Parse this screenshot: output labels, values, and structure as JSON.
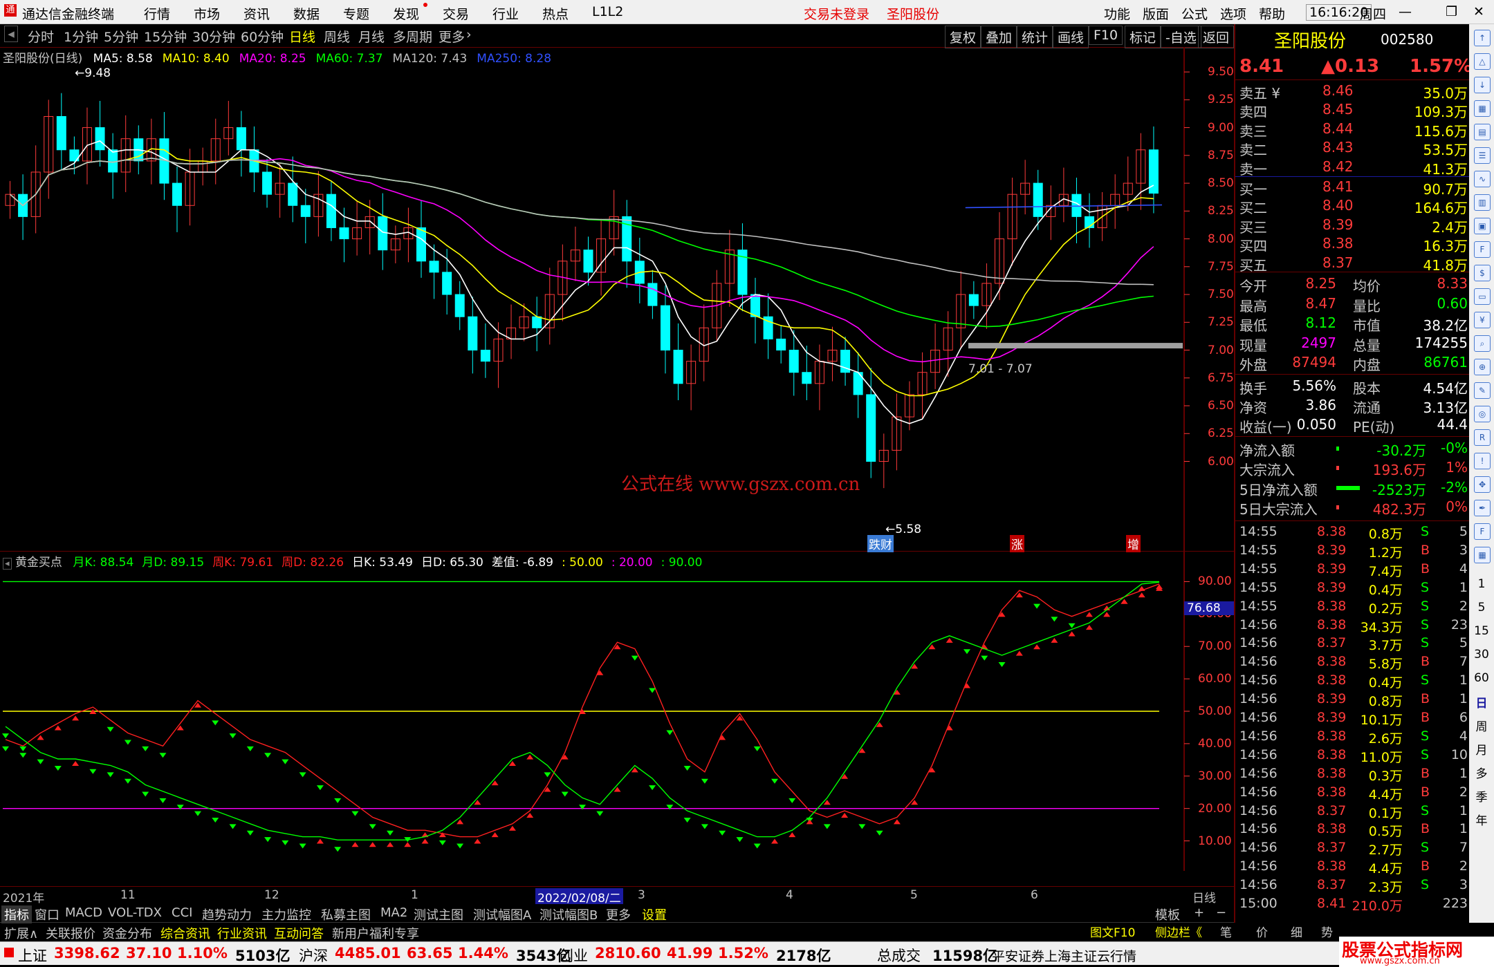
{
  "titlebar": {
    "app": "通达信金融终端",
    "menu": [
      "行情",
      "市场",
      "资讯",
      "数据",
      "专题",
      "发现",
      "交易",
      "行业",
      "热点",
      "L1L2"
    ],
    "login": "交易未登录",
    "stock": "圣阳股份",
    "right_menu": [
      "功能",
      "版面",
      "公式",
      "选项",
      "帮助"
    ],
    "time": "16:16:20",
    "weekday": "周四"
  },
  "toolbar": {
    "periods": [
      "分时",
      "1分钟",
      "5分钟",
      "15分钟",
      "30分钟",
      "60分钟",
      "日线",
      "周线",
      "月线",
      "多周期",
      "更多"
    ],
    "selected": "日线",
    "right": [
      "复权",
      "叠加",
      "统计",
      "画线",
      "F10",
      "标记",
      "-自选",
      "返回"
    ]
  },
  "ma_line": {
    "name": "圣阳股份(日线)",
    "items": [
      {
        "label": "MA5: 8.58",
        "color": "#ffffff"
      },
      {
        "label": "MA10: 8.40",
        "color": "#ffff00"
      },
      {
        "label": "MA20: 8.25",
        "color": "#ff00ff"
      },
      {
        "label": "MA60: 7.37",
        "color": "#00ff00"
      },
      {
        "label": "MA120: 7.43",
        "color": "#c0c0c0"
      },
      {
        "label": "MA250: 8.28",
        "color": "#3050ff"
      }
    ]
  },
  "price_axis": [
    "9.50",
    "9.25",
    "9.00",
    "8.75",
    "8.50",
    "8.25",
    "8.00",
    "7.75",
    "7.50",
    "7.25",
    "7.00",
    "6.75",
    "6.50",
    "6.25",
    "6.00"
  ],
  "annotations": {
    "high": "9.48",
    "low": "5.58",
    "range": "7.01 - 7.07",
    "watermark": "公式在线  www.gszx.com.cn",
    "tags": [
      "跌财",
      "涨",
      "增"
    ]
  },
  "indicator_line": {
    "name": "黄金买点",
    "items": [
      {
        "label": "月K: 88.54",
        "color": "#00ff00"
      },
      {
        "label": "月D: 89.15",
        "color": "#00ff00"
      },
      {
        "label": "周K: 79.61",
        "color": "#ff2020"
      },
      {
        "label": "周D: 82.26",
        "color": "#ff2020"
      },
      {
        "label": "日K: 53.49",
        "color": "#ffffff"
      },
      {
        "label": "日D: 65.30",
        "color": "#ffffff"
      },
      {
        "label": "差值: -6.89",
        "color": "#ffffff"
      }
    ],
    "levels": [
      {
        "label": ": 50.00",
        "color": "#ffff00"
      },
      {
        "label": ": 20.00",
        "color": "#ff00ff"
      },
      {
        "label": ": 90.00",
        "color": "#00ff00"
      }
    ]
  },
  "indicator_axis": [
    "90.00",
    "80.00",
    "70.00",
    "60.00",
    "50.00",
    "40.00",
    "30.00",
    "20.00",
    "10.00"
  ],
  "indicator_current": "76.68",
  "date_axis": {
    "labels": [
      "2021年",
      "11",
      "12",
      "1",
      "2022/02/08/二",
      "3",
      "4",
      "5",
      "6"
    ],
    "period": "日线"
  },
  "bottom_tabs": [
    "指标",
    "窗口",
    "MACD",
    "VOL-TDX",
    "CCI",
    "趋势动力",
    "主力监控",
    "私募主图",
    "MA2",
    "测试主图",
    "测试幅图A",
    "测试幅图B",
    "更多",
    "设置"
  ],
  "bottom_tabs2": [
    "扩展∧",
    "关联报价",
    "资金分布",
    "综合资讯",
    "行业资讯",
    "互动问答",
    "新用户福利专享"
  ],
  "bottom_right": [
    "模板",
    "+",
    "−"
  ],
  "panel": {
    "name": "圣阳股份",
    "code": "002580",
    "price": "8.41",
    "change": "▲0.13",
    "pct": "1.57%",
    "asks": [
      {
        "label": "卖五 ¥",
        "price": "8.46",
        "vol": "35.0万"
      },
      {
        "label": "卖四",
        "price": "8.45",
        "vol": "109.3万"
      },
      {
        "label": "卖三",
        "price": "8.44",
        "vol": "115.6万"
      },
      {
        "label": "卖二",
        "price": "8.43",
        "vol": "53.5万"
      },
      {
        "label": "卖一",
        "price": "8.42",
        "vol": "41.3万"
      }
    ],
    "bids": [
      {
        "label": "买一",
        "price": "8.41",
        "vol": "90.7万"
      },
      {
        "label": "买二",
        "price": "8.40",
        "vol": "164.6万"
      },
      {
        "label": "买三",
        "price": "8.39",
        "vol": "2.4万"
      },
      {
        "label": "买四",
        "price": "8.38",
        "vol": "16.3万"
      },
      {
        "label": "买五",
        "price": "8.37",
        "vol": "41.8万"
      }
    ],
    "stats": [
      {
        "k1": "今开",
        "v1": "8.25",
        "k2": "均价",
        "v2": "8.33",
        "c1": "#ff3b3b",
        "c2": "#ff3b3b"
      },
      {
        "k1": "最高",
        "v1": "8.47",
        "k2": "量比",
        "v2": "0.60",
        "c1": "#ff3b3b",
        "c2": "#00ff00"
      },
      {
        "k1": "最低",
        "v1": "8.12",
        "k2": "市值",
        "v2": "38.2亿",
        "c1": "#00ff00",
        "c2": "#ffffff"
      },
      {
        "k1": "现量",
        "v1": "2497",
        "k2": "总量",
        "v2": "174255",
        "c1": "#ff00ff",
        "c2": "#ffffff"
      },
      {
        "k1": "外盘",
        "v1": "87494",
        "k2": "内盘",
        "v2": "86761",
        "c1": "#ff3b3b",
        "c2": "#00ff00"
      }
    ],
    "stats2": [
      {
        "k1": "换手",
        "v1": "5.56%",
        "k2": "股本",
        "v2": "4.54亿"
      },
      {
        "k1": "净资",
        "v1": "3.86",
        "k2": "流通",
        "v2": "3.13亿"
      },
      {
        "k1": "收益(一)",
        "v1": "0.050",
        "k2": "PE(动)",
        "v2": "44.4"
      }
    ],
    "flows": [
      {
        "label": "净流入额",
        "value": "-30.2万",
        "pct": "-0%",
        "color": "#00ff00"
      },
      {
        "label": "大宗流入",
        "value": "193.6万",
        "pct": "1%",
        "color": "#ff3b3b"
      },
      {
        "label": "5日净流入额",
        "value": "-2523万",
        "pct": "-2%",
        "color": "#00ff00"
      },
      {
        "label": "5日大宗流入",
        "value": "482.3万",
        "pct": "0%",
        "color": "#ff3b3b"
      }
    ],
    "ticks": [
      {
        "t": "14:55",
        "p": "8.38",
        "v": "0.8万",
        "s": "S",
        "n": "5"
      },
      {
        "t": "14:55",
        "p": "8.39",
        "v": "1.2万",
        "s": "B",
        "n": "3"
      },
      {
        "t": "14:55",
        "p": "8.39",
        "v": "7.4万",
        "s": "B",
        "n": "4"
      },
      {
        "t": "14:55",
        "p": "8.39",
        "v": "0.4万",
        "s": "S",
        "n": "1"
      },
      {
        "t": "14:55",
        "p": "8.38",
        "v": "0.2万",
        "s": "S",
        "n": "2"
      },
      {
        "t": "14:56",
        "p": "8.38",
        "v": "34.3万",
        "s": "S",
        "n": "23"
      },
      {
        "t": "14:56",
        "p": "8.37",
        "v": "3.7万",
        "s": "S",
        "n": "5"
      },
      {
        "t": "14:56",
        "p": "8.38",
        "v": "5.8万",
        "s": "B",
        "n": "7"
      },
      {
        "t": "14:56",
        "p": "8.38",
        "v": "0.4万",
        "s": "S",
        "n": "1"
      },
      {
        "t": "14:56",
        "p": "8.39",
        "v": "0.8万",
        "s": "B",
        "n": "1"
      },
      {
        "t": "14:56",
        "p": "8.39",
        "v": "10.1万",
        "s": "B",
        "n": "6"
      },
      {
        "t": "14:56",
        "p": "8.38",
        "v": "2.6万",
        "s": "S",
        "n": "4"
      },
      {
        "t": "14:56",
        "p": "8.38",
        "v": "11.0万",
        "s": "S",
        "n": "10"
      },
      {
        "t": "14:56",
        "p": "8.38",
        "v": "0.3万",
        "s": "B",
        "n": "1"
      },
      {
        "t": "14:56",
        "p": "8.38",
        "v": "4.4万",
        "s": "B",
        "n": "2"
      },
      {
        "t": "14:56",
        "p": "8.37",
        "v": "0.1万",
        "s": "S",
        "n": "1"
      },
      {
        "t": "14:56",
        "p": "8.38",
        "v": "0.5万",
        "s": "B",
        "n": "1"
      },
      {
        "t": "14:56",
        "p": "8.37",
        "v": "2.7万",
        "s": "S",
        "n": "7"
      },
      {
        "t": "14:56",
        "p": "8.38",
        "v": "4.4万",
        "s": "B",
        "n": "2"
      },
      {
        "t": "14:56",
        "p": "8.37",
        "v": "2.3万",
        "s": "S",
        "n": "3"
      },
      {
        "t": "15:00",
        "p": "8.41",
        "v": "210.0万",
        "s": "",
        "n": "223"
      }
    ],
    "footer_tabs": [
      "图文F10",
      "侧边栏《",
      "笔",
      "价",
      "细",
      "势"
    ]
  },
  "sidebar": {
    "labels": [
      "日",
      "周",
      "月",
      "多",
      "季",
      "年"
    ],
    "numbers": [
      "1",
      "5",
      "15",
      "30",
      "60"
    ]
  },
  "statusbar": {
    "items": [
      {
        "name": "上证",
        "price": "3398.62",
        "chg": "37.10",
        "pct": "1.10%",
        "amt": "5103亿"
      },
      {
        "name": "沪深",
        "price": "4485.01",
        "chg": "63.65",
        "pct": "1.44%",
        "amt": "3543亿"
      },
      {
        "name": "创业",
        "price": "2810.60",
        "chg": "41.99",
        "pct": "1.52%",
        "amt": "2178亿"
      }
    ],
    "total_label": "总成交",
    "total": "11598亿",
    "server": "平安证券上海主证云行情",
    "brand": "股票公式指标网",
    "brand_url": "www.gszx.com.cn"
  },
  "colors": {
    "up": "#ff3b3b",
    "down": "#00ff00",
    "bg": "#000000",
    "ma5": "#ffffff",
    "ma10": "#ffff00",
    "ma20": "#ff00ff",
    "ma60": "#00ff00",
    "ma120": "#c0c0c0",
    "ma250": "#3050ff",
    "candle_down": "#00ffff"
  },
  "chart_data": [
    {
      "type": "line",
      "title": "圣阳股份(日线)",
      "ylim": [
        5.5,
        9.6
      ],
      "candles": [
        8.4,
        8.2,
        8.6,
        9.1,
        8.8,
        8.7,
        9.0,
        8.8,
        8.6,
        8.9,
        8.7,
        8.9,
        8.5,
        8.3,
        8.6,
        8.7,
        8.9,
        9.0,
        8.8,
        8.6,
        8.4,
        8.5,
        8.3,
        8.2,
        8.4,
        8.1,
        8.0,
        8.1,
        8.2,
        7.9,
        8.0,
        8.1,
        7.8,
        7.7,
        7.5,
        7.3,
        7.0,
        6.9,
        7.1,
        7.2,
        7.3,
        7.2,
        7.5,
        7.8,
        7.9,
        7.7,
        8.0,
        8.2,
        7.8,
        7.6,
        7.4,
        7.0,
        6.7,
        6.9,
        7.2,
        7.6,
        7.9,
        7.5,
        7.3,
        7.1,
        7.0,
        6.8,
        6.7,
        6.9,
        7.0,
        6.8,
        6.6,
        6.0,
        6.1,
        6.4,
        6.6,
        6.8,
        7.0,
        7.2,
        7.5,
        7.4,
        7.6,
        8.0,
        8.4,
        8.5,
        8.2,
        8.3,
        8.4,
        8.2,
        8.1,
        8.3,
        8.4,
        8.5,
        8.8,
        8.41
      ],
      "ma250": 8.28
    },
    {
      "type": "line",
      "title": "黄金买点",
      "ylim": [
        5,
        95
      ],
      "levels": [
        50,
        20,
        90
      ],
      "weekly": [
        40,
        38,
        42,
        45,
        48,
        50,
        46,
        42,
        40,
        38,
        45,
        52,
        48,
        44,
        40,
        38,
        36,
        32,
        28,
        24,
        20,
        16,
        14,
        12,
        12,
        11,
        10,
        10,
        12,
        14,
        18,
        26,
        36,
        50,
        62,
        70,
        68,
        58,
        45,
        34,
        30,
        42,
        48,
        40,
        30,
        24,
        18,
        16,
        18,
        16,
        14,
        16,
        22,
        32,
        45,
        58,
        70,
        80,
        86,
        84,
        80,
        78,
        80,
        82,
        84,
        86,
        88
      ],
      "monthly": [
        44,
        40,
        36,
        34,
        34,
        33,
        32,
        30,
        26,
        24,
        22,
        20,
        18,
        16,
        14,
        12,
        11,
        10,
        10,
        9,
        9,
        9,
        9,
        9,
        10,
        12,
        16,
        22,
        28,
        34,
        36,
        32,
        26,
        22,
        20,
        26,
        32,
        28,
        22,
        18,
        16,
        14,
        12,
        10,
        10,
        12,
        16,
        22,
        30,
        38,
        46,
        56,
        64,
        70,
        72,
        70,
        68,
        66,
        68,
        70,
        72,
        74,
        76,
        80,
        84,
        88,
        88.54
      ]
    }
  ]
}
